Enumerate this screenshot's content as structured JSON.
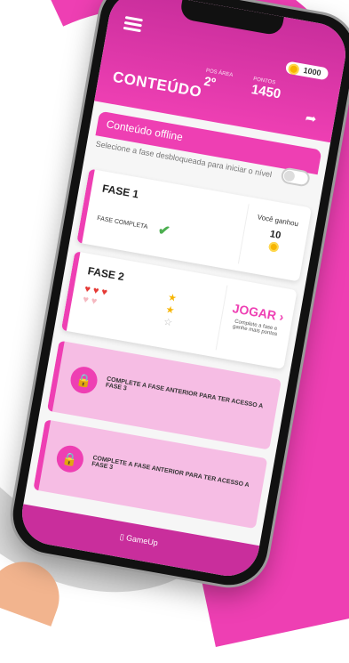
{
  "app": {
    "title": "CONTEÚDO",
    "coins": "1000",
    "position_label": "POS ÁREA",
    "position_value": "2º",
    "points_label": "PONTOS",
    "points_value": "1450"
  },
  "offline": {
    "label": "Conteúdo offline",
    "note": "Selecione a fase desbloqueada para iniciar o nível"
  },
  "levels": [
    {
      "title": "FASE 1",
      "status": "FASE COMPLETA",
      "reward_label": "Você ganhou",
      "reward_value": "10"
    },
    {
      "title": "FASE 2",
      "play_label": "JOGAR",
      "play_hint": "Complete a fase e ganhe mais pontos"
    }
  ],
  "locked": [
    {
      "text": "COMPLETE A FASE ANTERIOR PARA TER ACESSO A FASE 3"
    },
    {
      "text": "COMPLETE A FASE ANTERIOR PARA TER ACESSO A FASE 3"
    }
  ],
  "footer": {
    "label": "GameUp"
  },
  "colors": {
    "accent": "#ee3fb3",
    "accent_dark": "#c92e9c"
  },
  "icons": [
    "menu-icon",
    "coin-icon",
    "share-icon",
    "check-icon",
    "heart-icon",
    "star-icon",
    "lock-icon",
    "gameup-icon"
  ]
}
